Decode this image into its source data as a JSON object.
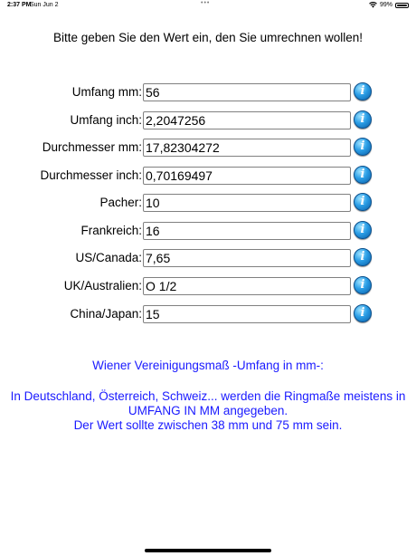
{
  "status_bar": {
    "time": "2:37 PM",
    "date": "Sun Jun 2",
    "dots": "•••",
    "battery_percent": "99%"
  },
  "prompt": "Bitte geben Sie den Wert ein, den Sie umrechnen wollen!",
  "fields": [
    {
      "label": "Umfang mm:",
      "value": "56",
      "icon": "info-icon"
    },
    {
      "label": "Umfang inch:",
      "value": "2,2047256",
      "icon": "info-icon"
    },
    {
      "label": "Durchmesser mm:",
      "value": "17,82304272",
      "icon": "info-icon"
    },
    {
      "label": "Durchmesser inch:",
      "value": "0,70169497",
      "icon": "info-icon"
    },
    {
      "label": "Pacher:",
      "value": "10",
      "icon": "info-icon"
    },
    {
      "label": "Frankreich:",
      "value": "16",
      "icon": "info-icon"
    },
    {
      "label": "US/Canada:",
      "value": "7,65",
      "icon": "info-icon"
    },
    {
      "label": "UK/Australien:",
      "value": "O 1/2",
      "icon": "info-icon"
    },
    {
      "label": "China/Japan:",
      "value": "15",
      "icon": "info-icon"
    }
  ],
  "info_button_glyph": "i",
  "info": {
    "title": "Wiener Vereinigungsmaß -Umfang in mm-:",
    "lines": [
      "In Deutschland, Österreich, Schweiz... werden die Ringmaße meistens in",
      "UMFANG IN MM angegeben.",
      "Der Wert sollte zwischen 38 mm und 75 mm sein."
    ]
  },
  "colors": {
    "info_text": "#1a1aff",
    "info_button": "#2b9ee6"
  }
}
